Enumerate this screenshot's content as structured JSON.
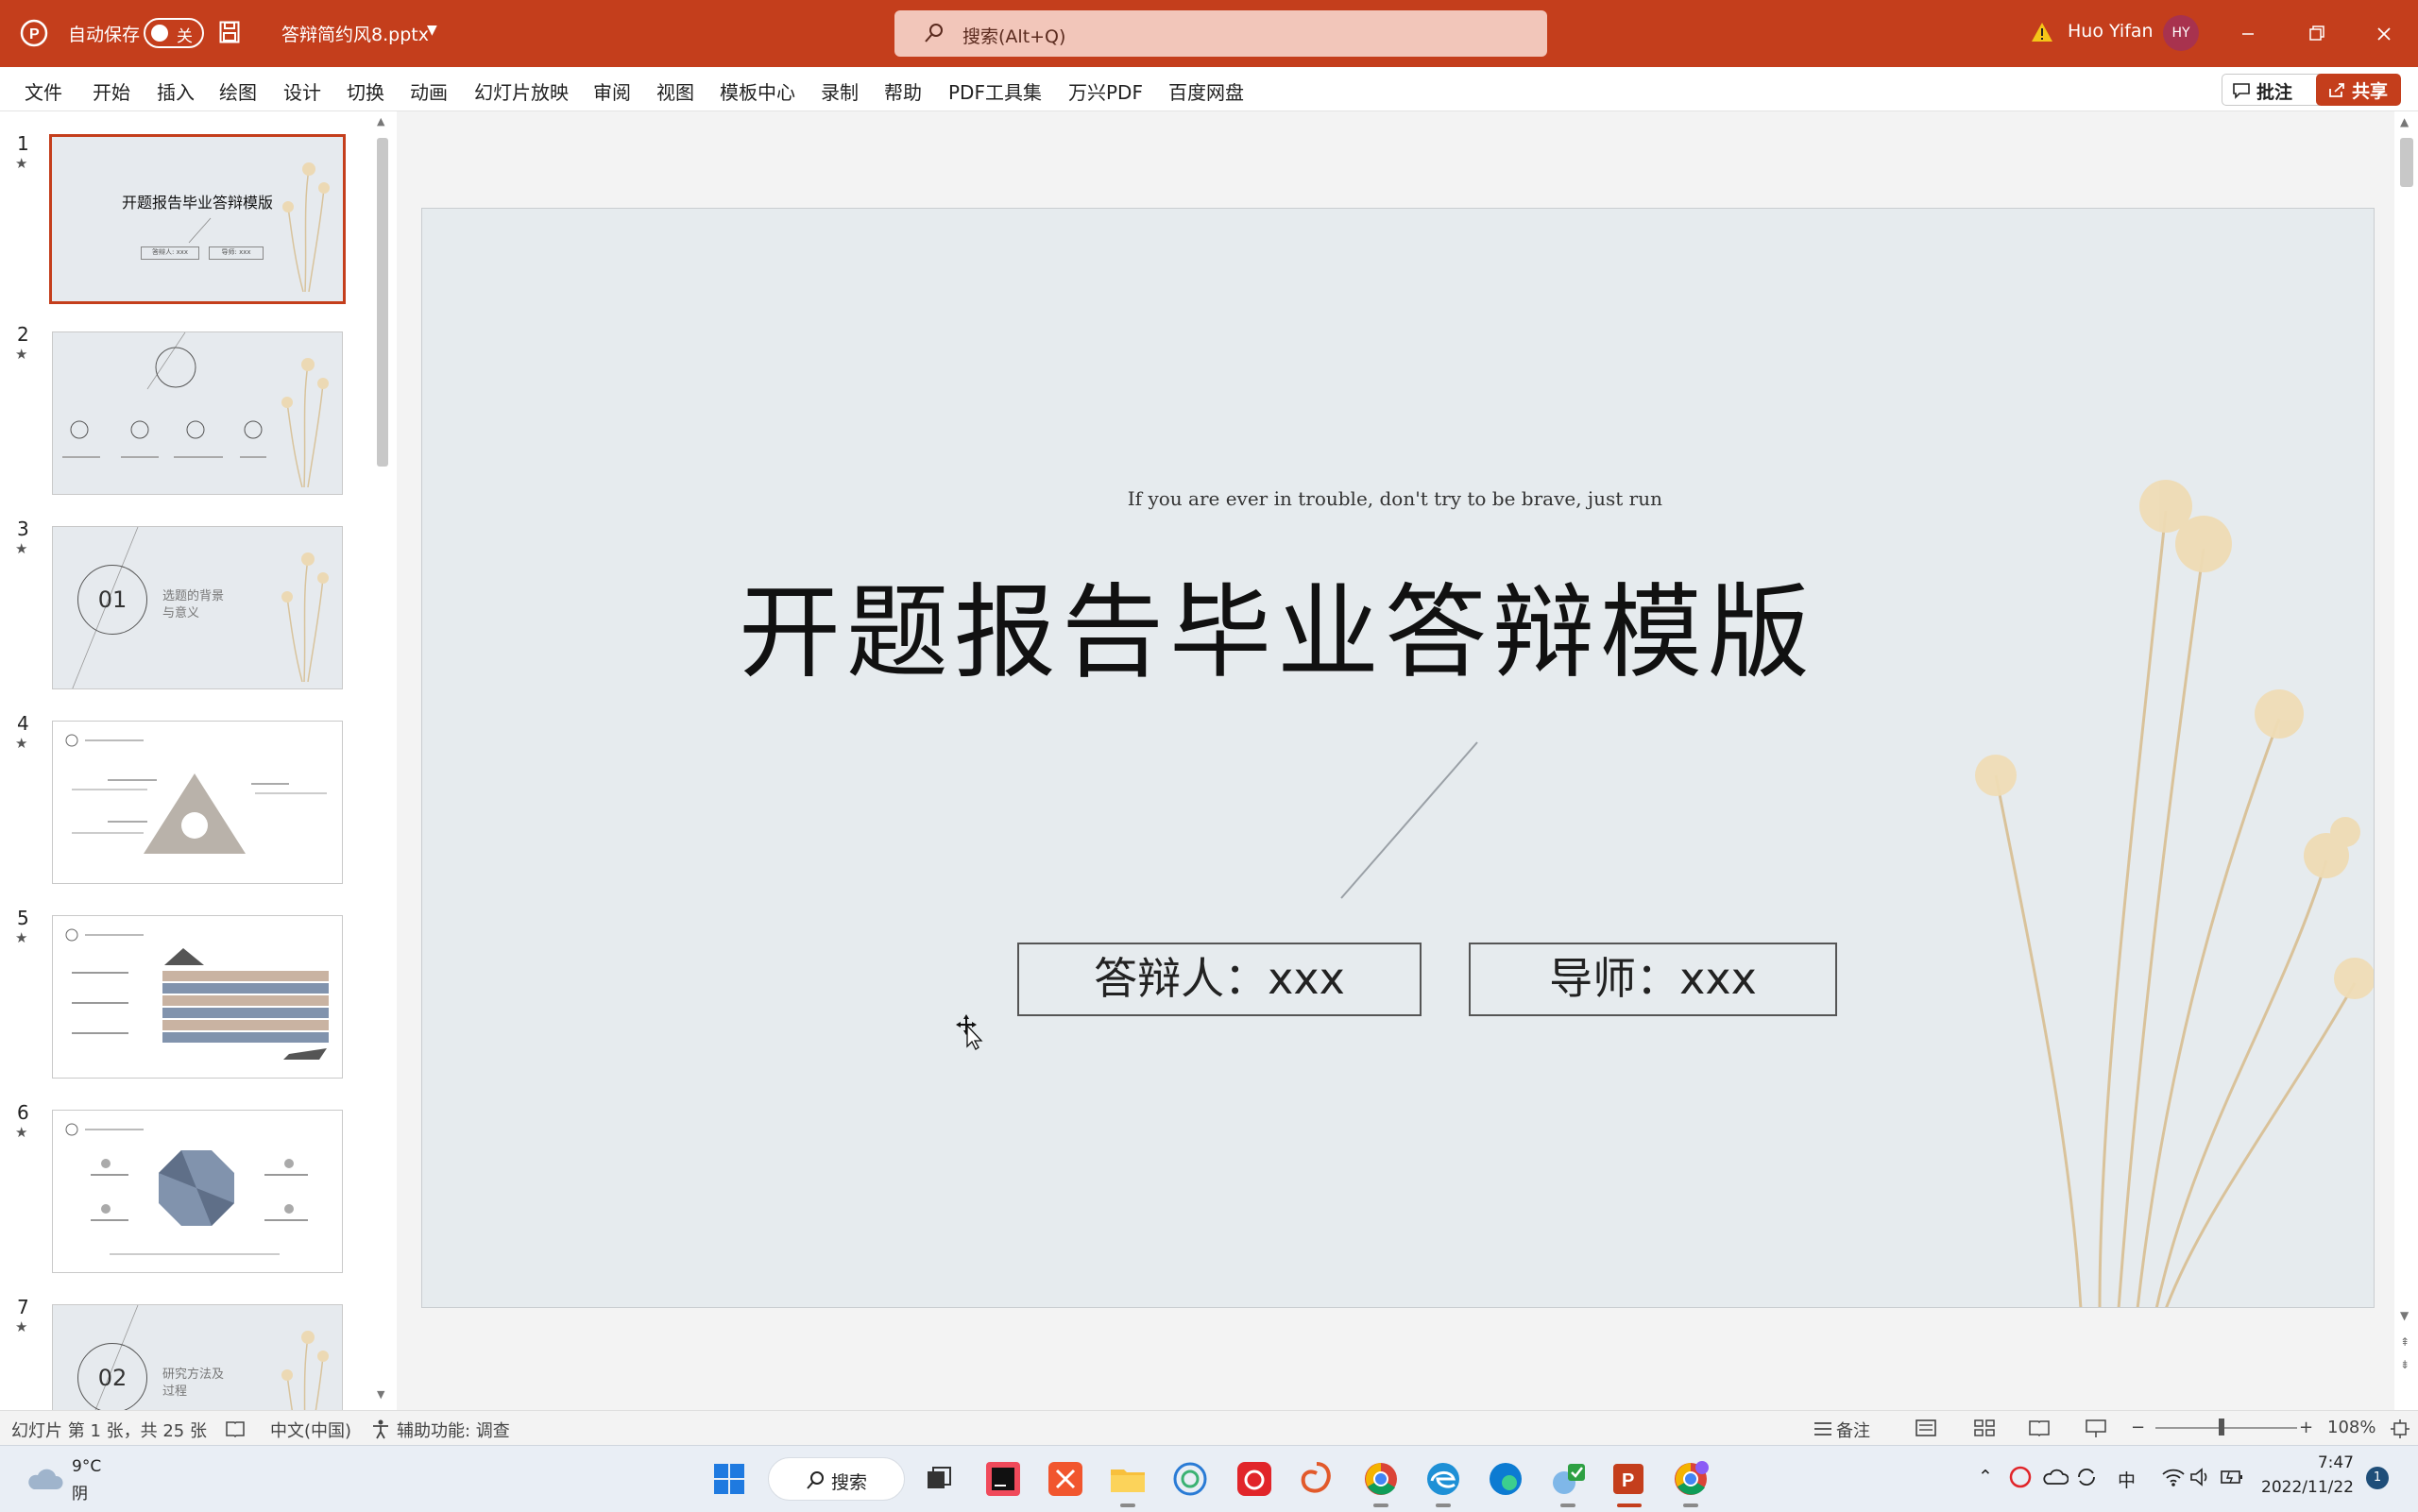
{
  "titlebar": {
    "autosave_label": "自动保存",
    "autosave_state": "关",
    "filename": "答辩简约风8.pptx",
    "search_placeholder": "搜索(Alt+Q)",
    "user_name": "Huo Yifan",
    "user_initials": "HY"
  },
  "ribbon": {
    "tabs": [
      "文件",
      "开始",
      "插入",
      "绘图",
      "设计",
      "切换",
      "动画",
      "幻灯片放映",
      "审阅",
      "视图",
      "模板中心",
      "录制",
      "帮助",
      "PDF工具集",
      "万兴PDF",
      "百度网盘"
    ],
    "comments_label": "批注",
    "share_label": "共享"
  },
  "thumbnails": {
    "numbers": [
      "1",
      "2",
      "3",
      "4",
      "5",
      "6",
      "7"
    ],
    "slide1_title": "开题报告毕业答辩模版",
    "slide1_box1": "答辩人: xxx",
    "slide1_box2": "导师: xxx",
    "slide3_num": "01",
    "slide3_text_1": "选题的背景",
    "slide3_text_2": "与意义",
    "slide7_num": "02",
    "slide7_text_1": "研究方法及",
    "slide7_text_2": "过程"
  },
  "slide": {
    "subtitle_en": "If you are ever in trouble, don't try to be brave, just run",
    "title": "开题报告毕业答辩模版",
    "presenter_box": "答辩人：xxx",
    "advisor_box": "导师：xxx"
  },
  "statusbar": {
    "slide_info": "幻灯片 第 1 张，共 25 张",
    "language": "中文(中国)",
    "accessibility": "辅助功能: 调查",
    "notes_label": "备注",
    "zoom": "108%"
  },
  "taskbar": {
    "temperature": "9°C",
    "weather": "阴",
    "search_label": "搜索",
    "ime": "中",
    "time": "7:47",
    "date": "2022/11/22",
    "notifications": "1"
  },
  "colors": {
    "accent": "#c43e1c",
    "slide_bg": "#e6ebee",
    "editor_bg": "#f3f3f3"
  }
}
